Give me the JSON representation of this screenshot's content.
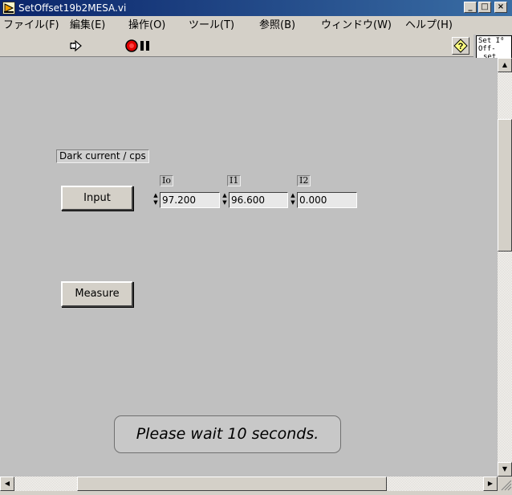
{
  "window": {
    "title": "SetOffset19b2MESA.vi",
    "minimize_glyph": "_",
    "maximize_glyph": "□",
    "close_glyph": "×"
  },
  "menu": [
    {
      "label": "ファイル(F)"
    },
    {
      "label": "編集(E)"
    },
    {
      "label": "操作(O)"
    },
    {
      "label": "ツール(T)"
    },
    {
      "label": "参照(B)"
    },
    {
      "label": "ウィンドウ(W)"
    },
    {
      "label": "ヘルプ(H)"
    }
  ],
  "toolbar": {
    "run_icon": "run-arrow-icon",
    "abort_icon": "abort-stop-icon",
    "pause_icon": "pause-icon",
    "help_icon": "question-help-icon",
    "help_glyph": "?"
  },
  "vi_icon": {
    "lines": [
      "Set I⁰",
      "Off-",
      "set"
    ]
  },
  "panel": {
    "dark_current_label": "Dark current / cps",
    "input_button_label": "Input",
    "measure_button_label": "Measure",
    "channels": [
      {
        "label": "Io",
        "value": "97.200"
      },
      {
        "label": "I1",
        "value": "96.600"
      },
      {
        "label": "I2",
        "value": "0.000"
      }
    ],
    "status_message": "Please wait 10 seconds."
  },
  "colors": {
    "titlebar_start": "#0a246a",
    "titlebar_end": "#3a6ea5",
    "panel_bg": "#c0c0c0",
    "abort_red": "#e00000"
  }
}
